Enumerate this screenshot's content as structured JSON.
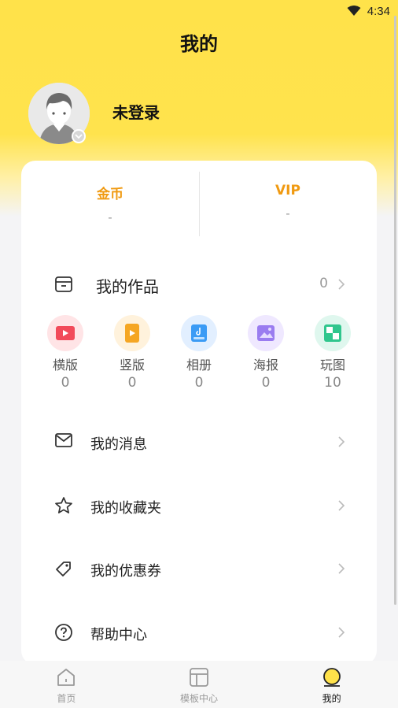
{
  "status_bar": {
    "time": "4:34",
    "wifi_icon": "wifi-icon"
  },
  "header": {
    "title": "我的"
  },
  "profile": {
    "username": "未登录",
    "avatar_icon": "default-avatar-icon"
  },
  "stats": [
    {
      "label": "金币",
      "value": "-"
    },
    {
      "label": "VIP",
      "value": "-"
    }
  ],
  "works": {
    "title": "我的作品",
    "count": "0",
    "items": [
      {
        "label": "横版",
        "count": "0",
        "icon": "landscape-video-icon",
        "bg": "#ffe4e6",
        "color": "#f24a5a"
      },
      {
        "label": "竖版",
        "count": "0",
        "icon": "portrait-video-icon",
        "bg": "#fff2dc",
        "color": "#f5a623"
      },
      {
        "label": "相册",
        "count": "0",
        "icon": "album-icon",
        "bg": "#e2efff",
        "color": "#3b9bf5"
      },
      {
        "label": "海报",
        "count": "0",
        "icon": "poster-icon",
        "bg": "#efe8ff",
        "color": "#9a7cf0"
      },
      {
        "label": "玩图",
        "count": "10",
        "icon": "play-image-icon",
        "bg": "#dff7ee",
        "color": "#2fc68d"
      }
    ]
  },
  "menu": [
    {
      "label": "我的消息",
      "icon": "mail-icon"
    },
    {
      "label": "我的收藏夹",
      "icon": "star-icon"
    },
    {
      "label": "我的优惠券",
      "icon": "coupon-tag-icon"
    },
    {
      "label": "帮助中心",
      "icon": "help-circle-icon"
    }
  ],
  "bottom_nav": [
    {
      "label": "首页",
      "icon": "home-icon",
      "active": false
    },
    {
      "label": "模板中心",
      "icon": "template-icon",
      "active": false
    },
    {
      "label": "我的",
      "icon": "profile-tab-icon",
      "active": true
    }
  ],
  "colors": {
    "accent": "#ffe24a",
    "stat_label": "#f09a12"
  }
}
